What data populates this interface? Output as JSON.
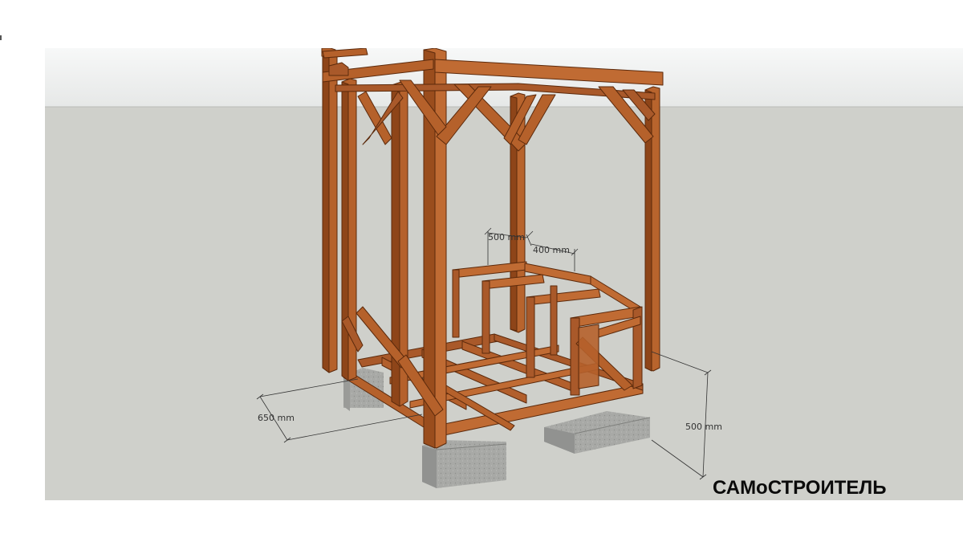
{
  "dimensions": {
    "top_width": "500 mm",
    "top_depth": "400 mm",
    "base_depth": "650 mm",
    "height": "500 mm"
  },
  "watermark": "САМоСТРОИТЕЛЬ",
  "colors": {
    "sky": "#eef0ef",
    "ground": "#cfd0cb",
    "wood": "#b5612b",
    "wood_dark": "#7a3a14",
    "wood_light": "#cd7a40",
    "concrete": "#a9aaa8",
    "concrete_dark": "#8d8e8b"
  }
}
